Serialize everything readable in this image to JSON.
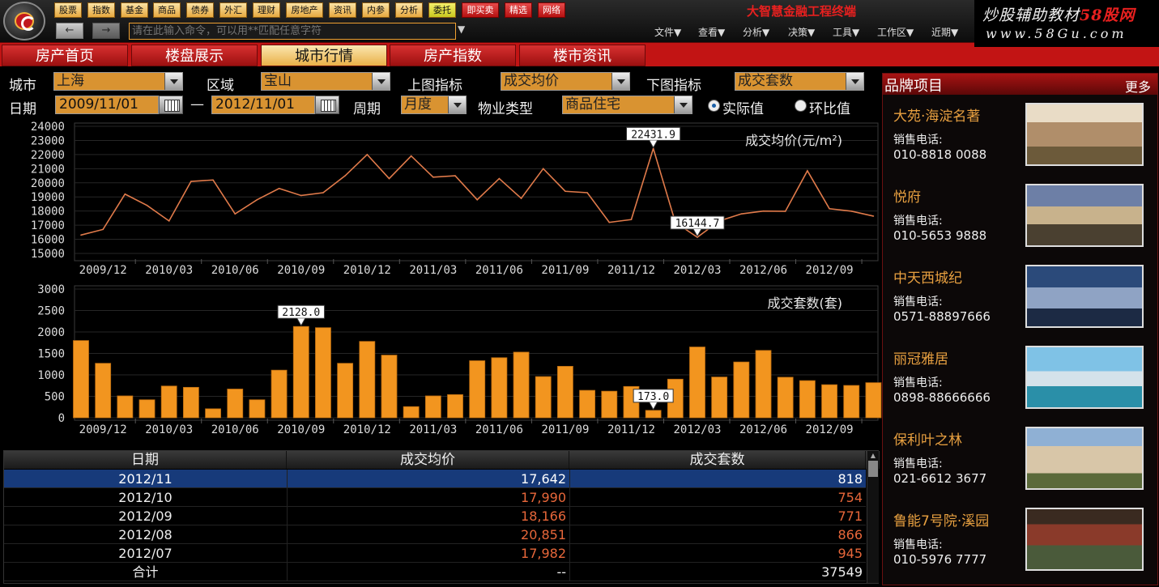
{
  "menu": {
    "buttons": [
      "股票",
      "指数",
      "基金",
      "商品",
      "债券",
      "外汇",
      "理财",
      "房地产",
      "资讯",
      "内参",
      "分析",
      "委托",
      "即买卖",
      "精选",
      "网络"
    ],
    "app_title": "大智慧金融工程终端",
    "command_placeholder": "请在此输入命令，可以用**匹配任意字符",
    "top_menus": [
      "文件▼",
      "查看▼",
      "分析▼",
      "决策▼",
      "工具▼",
      "工作区▼",
      "近期▼"
    ]
  },
  "brand": {
    "line1a": "炒股辅助教材",
    "line1b": "58股网",
    "line2": "www.58Gu.com"
  },
  "tabs": [
    "房产首页",
    "楼盘展示",
    "城市行情",
    "房产指数",
    "楼市资讯"
  ],
  "filters": {
    "city_label": "城市",
    "city": "上海",
    "district_label": "区域",
    "district": "宝山",
    "upper_label": "上图指标",
    "upper": "成交均价",
    "lower_label": "下图指标",
    "lower": "成交套数",
    "date_label": "日期",
    "date_from": "2009/11/01",
    "dash": "—",
    "date_to": "2012/11/01",
    "period_label": "周期",
    "period": "月度",
    "type_label": "物业类型",
    "type": "商品住宅",
    "radio_actual": "实际值",
    "radio_mom": "环比值"
  },
  "colors": {
    "accent": "#e8901a",
    "line": "#e07a4a",
    "bar": "#f2951f",
    "tab_red": "#c21414"
  },
  "chart_data": [
    {
      "type": "line",
      "title": "成交均价(元/m²)",
      "x": [
        "2009/11",
        "2009/12",
        "2010/01",
        "2010/02",
        "2010/03",
        "2010/04",
        "2010/05",
        "2010/06",
        "2010/07",
        "2010/08",
        "2010/09",
        "2010/10",
        "2010/11",
        "2010/12",
        "2011/01",
        "2011/02",
        "2011/03",
        "2011/04",
        "2011/05",
        "2011/06",
        "2011/07",
        "2011/08",
        "2011/09",
        "2011/10",
        "2011/11",
        "2011/12",
        "2012/01",
        "2012/02",
        "2012/03",
        "2012/04",
        "2012/05",
        "2012/06",
        "2012/07",
        "2012/08",
        "2012/09",
        "2012/10",
        "2012/11"
      ],
      "values": [
        16300,
        16700,
        19200,
        18400,
        17300,
        20100,
        20200,
        17800,
        18800,
        19600,
        19100,
        19300,
        20500,
        22000,
        20300,
        21900,
        20400,
        20500,
        18800,
        20300,
        18900,
        21000,
        19400,
        19300,
        17200,
        17400,
        22431.9,
        17200,
        16144.7,
        17300,
        17800,
        18000,
        17982,
        20851,
        18166,
        17990,
        17642
      ],
      "xticks": [
        "2009/12",
        "2010/03",
        "2010/06",
        "2010/09",
        "2010/12",
        "2011/03",
        "2011/06",
        "2011/09",
        "2011/12",
        "2012/03",
        "2012/06",
        "2012/09"
      ],
      "yticks": [
        15000,
        16000,
        17000,
        18000,
        19000,
        20000,
        21000,
        22000,
        23000,
        24000
      ],
      "ylim": [
        15000,
        24000
      ],
      "annotations": [
        {
          "label": "22431.9",
          "index": 26
        },
        {
          "label": "16144.7",
          "index": 28
        }
      ]
    },
    {
      "type": "bar",
      "title": "成交套数(套)",
      "x": [
        "2009/11",
        "2009/12",
        "2010/01",
        "2010/02",
        "2010/03",
        "2010/04",
        "2010/05",
        "2010/06",
        "2010/07",
        "2010/08",
        "2010/09",
        "2010/10",
        "2010/11",
        "2010/12",
        "2011/01",
        "2011/02",
        "2011/03",
        "2011/04",
        "2011/05",
        "2011/06",
        "2011/07",
        "2011/08",
        "2011/09",
        "2011/10",
        "2011/11",
        "2011/12",
        "2012/01",
        "2012/02",
        "2012/03",
        "2012/04",
        "2012/05",
        "2012/06",
        "2012/07",
        "2012/08",
        "2012/09",
        "2012/10",
        "2012/11"
      ],
      "values": [
        1800,
        1270,
        510,
        420,
        740,
        710,
        210,
        670,
        420,
        1110,
        2128,
        2100,
        1270,
        1780,
        1460,
        260,
        510,
        540,
        1330,
        1400,
        1530,
        960,
        1200,
        640,
        620,
        730,
        173,
        900,
        1650,
        950,
        1300,
        1570,
        945,
        866,
        771,
        754,
        818
      ],
      "xticks": [
        "2009/12",
        "2010/03",
        "2010/06",
        "2010/09",
        "2010/12",
        "2011/03",
        "2011/06",
        "2011/09",
        "2011/12",
        "2012/03",
        "2012/06",
        "2012/09"
      ],
      "yticks": [
        0,
        500,
        1000,
        1500,
        2000,
        2500,
        3000
      ],
      "ylim": [
        0,
        3000
      ],
      "annotations": [
        {
          "label": "2128.0",
          "index": 10
        },
        {
          "label": "173.0",
          "index": 26
        }
      ]
    }
  ],
  "table": {
    "headers": [
      "日期",
      "成交均价",
      "成交套数"
    ],
    "rows": [
      [
        "2012/11",
        "17,642",
        "818"
      ],
      [
        "2012/10",
        "17,990",
        "754"
      ],
      [
        "2012/09",
        "18,166",
        "771"
      ],
      [
        "2012/08",
        "20,851",
        "866"
      ],
      [
        "2012/07",
        "17,982",
        "945"
      ]
    ],
    "total": [
      "合计",
      "--",
      "37549"
    ]
  },
  "side": {
    "title": "品牌项目",
    "more": "更多",
    "items": [
      {
        "name": "大苑·海淀名著",
        "phone_label": "销售电话:",
        "phone": "010-8818 0088"
      },
      {
        "name": "悦府",
        "phone_label": "销售电话:",
        "phone": "010-5653 9888"
      },
      {
        "name": "中天西城纪",
        "phone_label": "销售电话:",
        "phone": "0571-88897666"
      },
      {
        "name": "丽冠雅居",
        "phone_label": "销售电话:",
        "phone": "0898-88666666"
      },
      {
        "name": "保利叶之林",
        "phone_label": "销售电话:",
        "phone": "021-6612 3677"
      },
      {
        "name": "鲁能7号院·溪园",
        "phone_label": "销售电话:",
        "phone": "010-5976 7777"
      }
    ]
  }
}
